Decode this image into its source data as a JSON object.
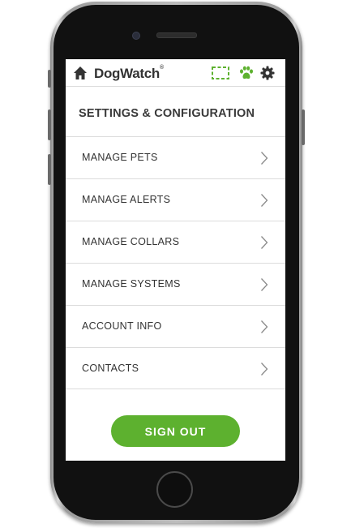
{
  "header": {
    "brand": "DogWatch",
    "brand_mark": "®",
    "icons": [
      "home-icon",
      "scan-icon",
      "paw-icon",
      "gear-icon"
    ]
  },
  "page": {
    "title": "SETTINGS & CONFIGURATION"
  },
  "menu": {
    "items": [
      {
        "label": "MANAGE PETS"
      },
      {
        "label": "MANAGE ALERTS"
      },
      {
        "label": "MANAGE COLLARS"
      },
      {
        "label": "MANAGE SYSTEMS"
      },
      {
        "label": "ACCOUNT INFO"
      },
      {
        "label": "CONTACTS"
      }
    ]
  },
  "actions": {
    "sign_out_label": "SIGN OUT"
  },
  "colors": {
    "accent_green": "#5db12f",
    "icon_dark": "#333333",
    "divider": "#dcdcdc"
  }
}
